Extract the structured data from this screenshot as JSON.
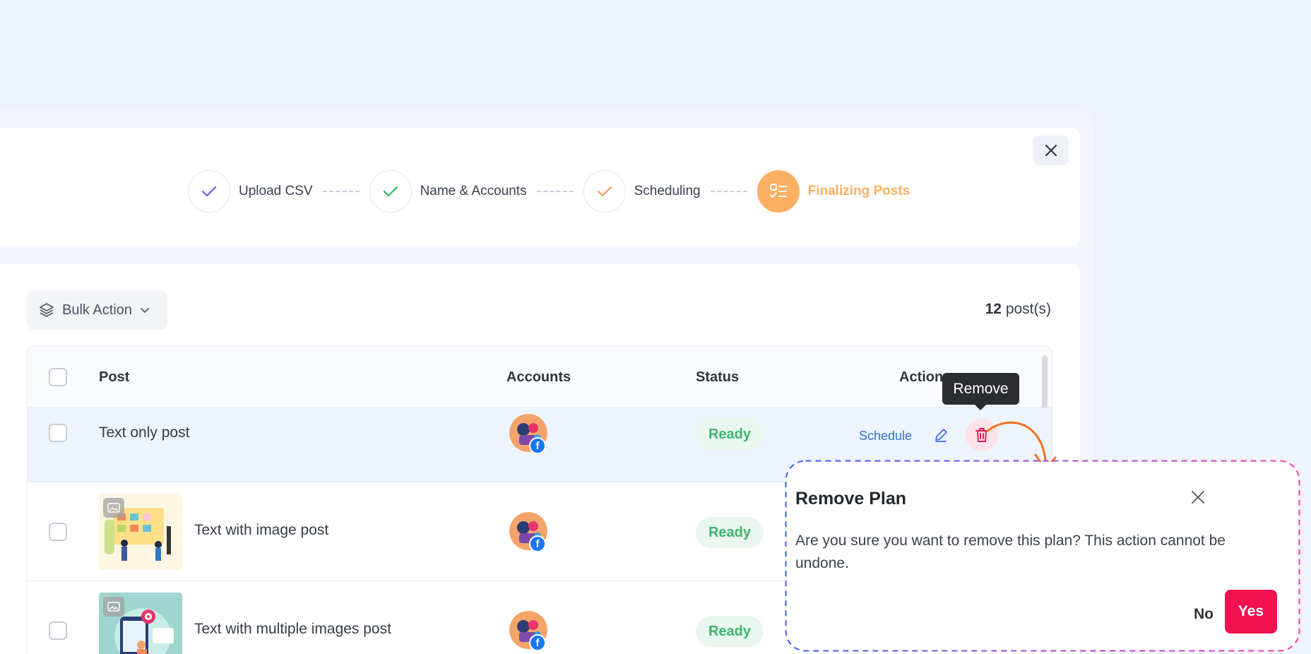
{
  "stepper": {
    "steps": [
      {
        "label": "Upload CSV",
        "state": "done",
        "color": "#6b72e8"
      },
      {
        "label": "Name & Accounts",
        "state": "done",
        "color": "#3fbf73"
      },
      {
        "label": "Scheduling",
        "state": "done",
        "color": "#f59e6e"
      },
      {
        "label": "Finalizing Posts",
        "state": "active",
        "color": "#fbb064"
      }
    ]
  },
  "toolbar": {
    "bulk_action_label": "Bulk Action",
    "post_count": "12",
    "post_count_suffix": " post(s)"
  },
  "table": {
    "columns": {
      "post": "Post",
      "accounts": "Accounts",
      "status": "Status",
      "actions": "Actions"
    },
    "rows": [
      {
        "post": "Text only post",
        "status": "Ready",
        "account_badge": "f"
      },
      {
        "post": "Text with image post",
        "status": "Ready",
        "account_badge": "f"
      },
      {
        "post": "Text with multiple images post",
        "status": "Ready",
        "account_badge": "f"
      }
    ],
    "schedule_label": "Schedule"
  },
  "tooltip": {
    "text": "Remove"
  },
  "modal": {
    "title": "Remove Plan",
    "body": "Are you sure you want to remove this plan? This action cannot be undone.",
    "no_label": "No",
    "yes_label": "Yes"
  },
  "colors": {
    "accent": "#fbb064",
    "danger": "#f0114e",
    "ready_text": "#3fb36c",
    "link": "#2f6fdd"
  }
}
